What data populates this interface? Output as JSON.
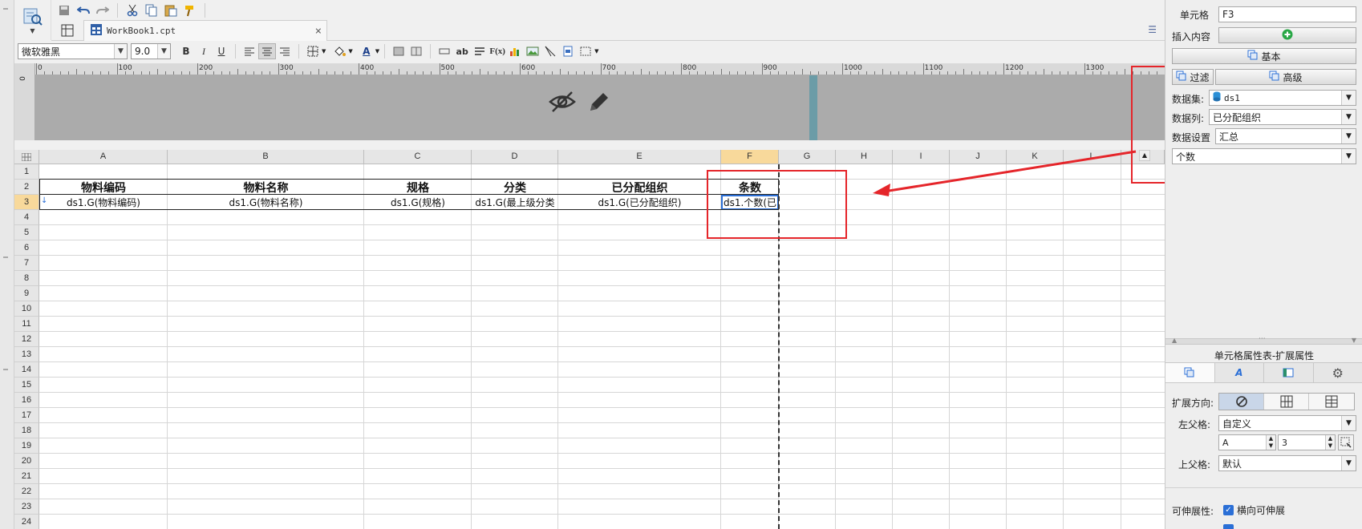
{
  "toolbar": {
    "tab_name": "WorkBook1.cpt",
    "font_name": "微软雅黑",
    "font_size": "9.0",
    "bold": "B",
    "italic": "I",
    "underline": "U",
    "text_ab": "ab",
    "formula_fx": "F(x)"
  },
  "ruler": {
    "top_labels": [
      "0",
      "100",
      "200",
      "300",
      "400",
      "500",
      "600",
      "700",
      "800",
      "900",
      "1000",
      "1100",
      "1200",
      "1300"
    ],
    "left_label": "0"
  },
  "grid": {
    "columns": [
      "A",
      "B",
      "C",
      "D",
      "E",
      "F",
      "G",
      "H",
      "I",
      "J",
      "K",
      "L"
    ],
    "selected_column": "F",
    "rows": [
      "1",
      "2",
      "3",
      "4",
      "5",
      "6",
      "7",
      "8",
      "9",
      "10",
      "11",
      "12",
      "13",
      "14",
      "15",
      "16",
      "17",
      "18",
      "19",
      "20",
      "21",
      "22",
      "23",
      "24"
    ],
    "selected_row": "3",
    "header_row": [
      "物料编码",
      "物料名称",
      "规格",
      "分类",
      "已分配组织",
      "条数"
    ],
    "data_row": [
      "ds1.G(物料编码)",
      "ds1.G(物料名称)",
      "ds1.G(规格)",
      "ds1.G(最上级分类",
      "ds1.G(已分配组织)",
      "ds1.个数(已"
    ]
  },
  "panel": {
    "cell_label": "单元格",
    "cell_value": "F3",
    "insert_label": "插入内容",
    "basic_button": "基本",
    "filter_button": "过滤",
    "advanced_button": "高级",
    "dataset_label": "数据集:",
    "dataset_value": "ds1",
    "datacol_label": "数据列:",
    "datacol_value": "已分配组织",
    "dataset_setting_label": "数据设置",
    "dataset_setting_value": "汇总",
    "aggregate_value": "个数",
    "props_title": "单元格属性表-扩展属性",
    "expand_dir_label": "扩展方向:",
    "left_parent_label": "左父格:",
    "left_parent_value": "自定义",
    "left_parent_col": "A",
    "left_parent_row": "3",
    "up_parent_label": "上父格:",
    "up_parent_value": "默认",
    "stretch_label": "可伸展性:",
    "stretch_h_label": "横向可伸展"
  },
  "colors": {
    "accent": "#2b6fd6",
    "annotation_red": "#e5252a",
    "header_band": "#ababab",
    "selected_header": "#f8d99b"
  }
}
